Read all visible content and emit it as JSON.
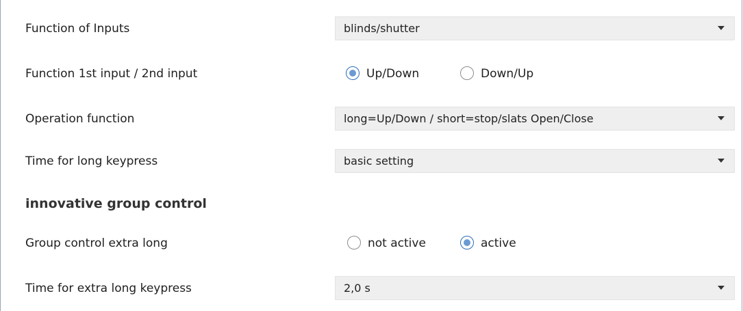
{
  "rows": {
    "function_of_inputs": {
      "label": "Function of Inputs",
      "value": "blinds/shutter"
    },
    "function_1st_2nd": {
      "label": "Function 1st input / 2nd input",
      "options": [
        "Up/Down",
        "Down/Up"
      ],
      "selected": "Up/Down"
    },
    "operation_function": {
      "label": "Operation function",
      "value": "long=Up/Down / short=stop/slats Open/Close"
    },
    "time_long_keypress": {
      "label": "Time for long keypress",
      "value": "basic setting"
    },
    "section_heading": "innovative group control",
    "group_control_extra_long": {
      "label": "Group control extra long",
      "options": [
        "not active",
        "active"
      ],
      "selected": "active"
    },
    "time_extra_long_keypress": {
      "label": "Time for extra long keypress",
      "value": "2,0 s"
    }
  },
  "colors": {
    "select_bg": "#efefef",
    "radio_accent": "#2a6bb8",
    "border": "#9aa3ad"
  },
  "icons": {
    "dropdown": "caret-down-icon",
    "radio": "radio-button-icon"
  }
}
